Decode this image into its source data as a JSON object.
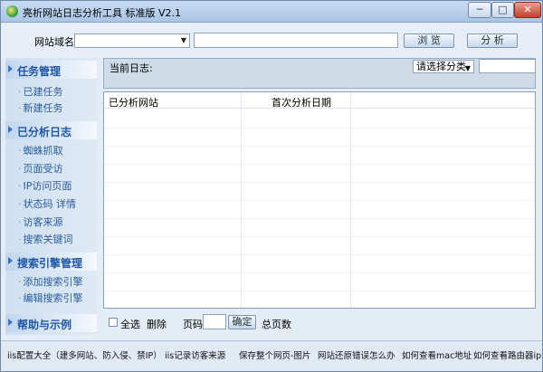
{
  "window": {
    "title": "亮析网站日志分析工具 标准版 V2.1",
    "minimize": "─",
    "maximize": "□",
    "close": "✕"
  },
  "topbar": {
    "site_label": "网站域名:",
    "site_value": "",
    "path_value": "",
    "browse_label": "浏 览",
    "analyze_label": "分 析"
  },
  "sidebar": {
    "sections": [
      {
        "label": "任务管理",
        "items": [
          "已建任务",
          "新建任务"
        ]
      },
      {
        "label": "已分析日志",
        "items": [
          "蜘蛛抓取",
          "页面受访",
          "IP访问页面",
          "状态码  详情",
          "访客来源",
          "搜索关键词"
        ]
      },
      {
        "label": "搜索引擎管理",
        "items": [
          "添加搜索引擎",
          "编辑搜索引擎"
        ]
      },
      {
        "label": "帮助与示例",
        "items": []
      }
    ]
  },
  "main": {
    "current_log_label": "当前日志:",
    "category_select": "请选择分类",
    "category_input": "",
    "columns": [
      "已分析网站",
      "首次分析日期"
    ],
    "rows": []
  },
  "bottom": {
    "select_all": "全选",
    "delete": "删除",
    "page_label": "页码",
    "page_value": "",
    "ok_label": "确定",
    "total_pages": "总页数"
  },
  "footer": {
    "links": [
      "iis配置大全（建多网站、防入侵、禁IP）",
      "iis记录访客来源",
      "保存整个网页-图片",
      "网站还原错误怎么办",
      "如何查看mac地址",
      "如何查看路由器ip"
    ]
  }
}
